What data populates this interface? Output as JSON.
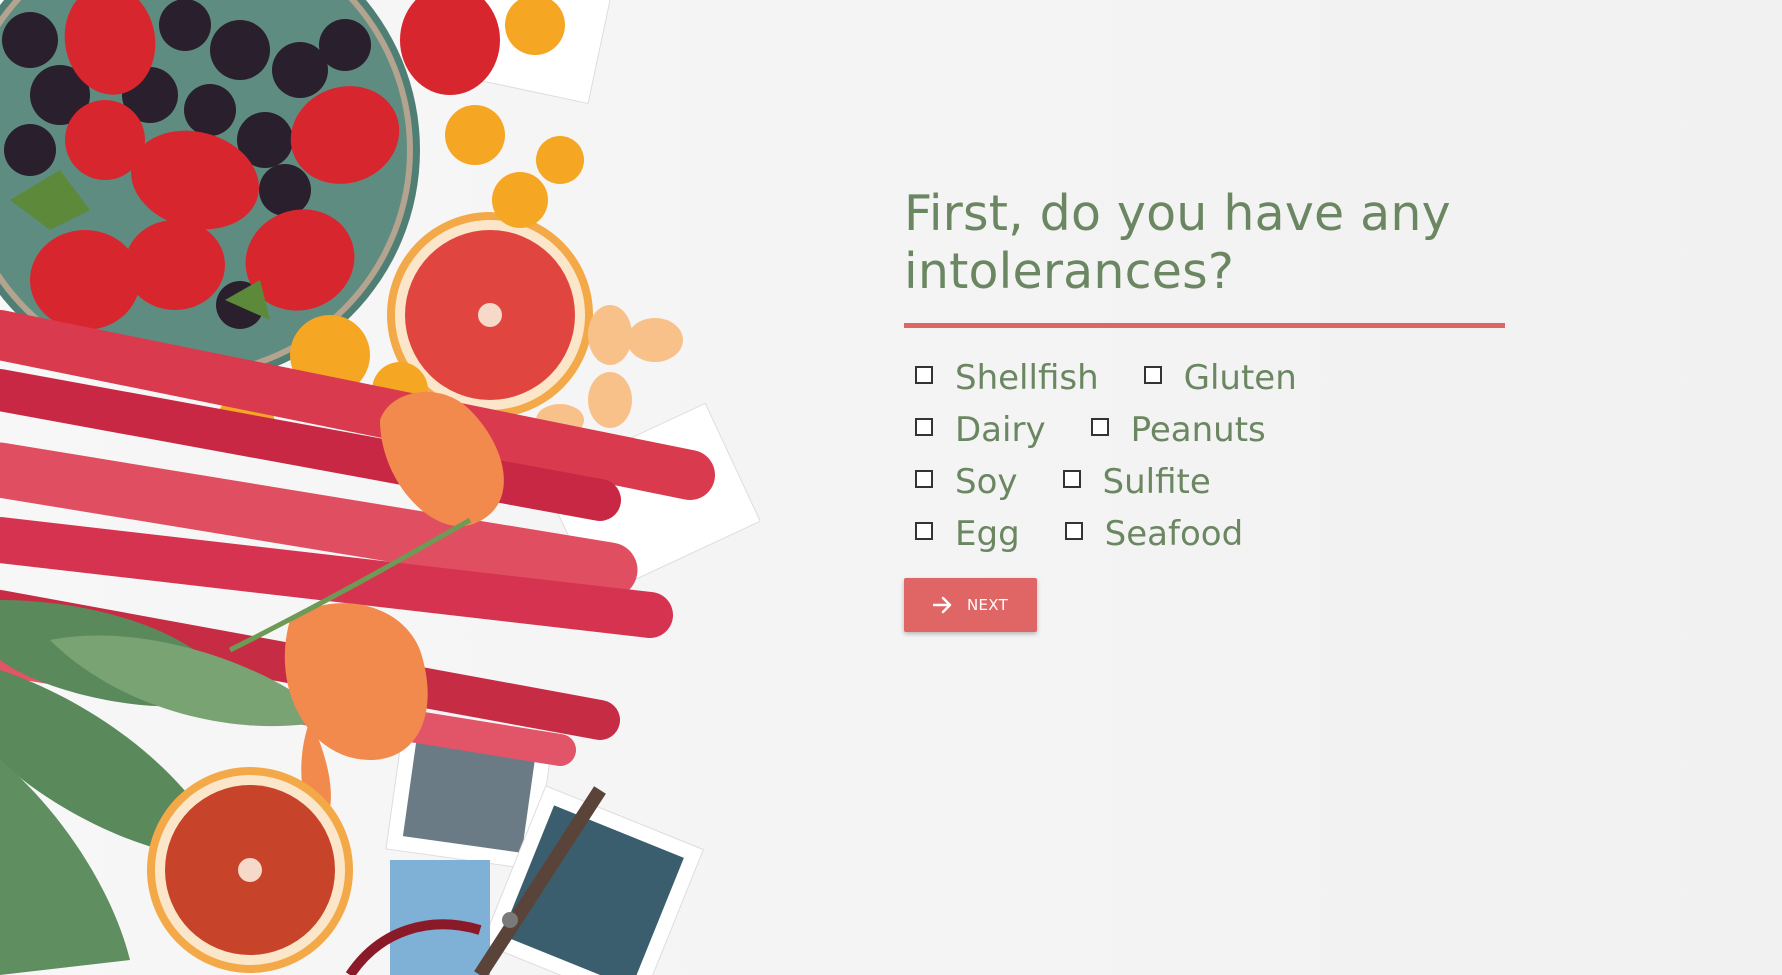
{
  "question": {
    "title": "First, do you have any intolerances?"
  },
  "options": [
    [
      "Shellfish",
      "Gluten"
    ],
    [
      "Dairy",
      "Peanuts"
    ],
    [
      "Soy",
      "Sulfite"
    ],
    [
      "Egg",
      "Seafood"
    ]
  ],
  "flat_options": {
    "shellfish": "Shellfish",
    "gluten": "Gluten",
    "dairy": "Dairy",
    "peanuts": "Peanuts",
    "soy": "Soy",
    "sulfite": "Sulfite",
    "egg": "Egg",
    "seafood": "Seafood"
  },
  "next_button": {
    "label": "NEXT",
    "icon": "arrow-right-icon"
  },
  "colors": {
    "accent": "#e06666",
    "text_green": "#6b8762"
  }
}
